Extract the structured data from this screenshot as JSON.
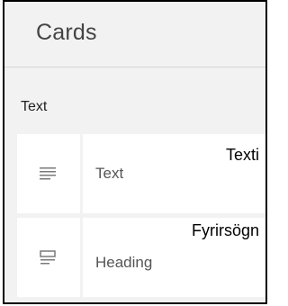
{
  "header": {
    "title": "Cards"
  },
  "section": {
    "label": "Text"
  },
  "cards": [
    {
      "label": "Text",
      "icon": "text-lines-icon"
    },
    {
      "label": "Heading",
      "icon": "heading-icon"
    }
  ],
  "overlays": [
    {
      "text": "Texti"
    },
    {
      "text": "Fyrirsögn"
    }
  ],
  "colors": {
    "background": "#f2f2f2",
    "card": "#ffffff",
    "icon": "#7a7a7a",
    "text": "#555555"
  }
}
